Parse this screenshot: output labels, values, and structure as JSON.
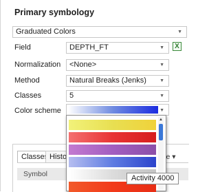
{
  "panel": {
    "title": "Primary symbology",
    "renderer": "Graduated Colors"
  },
  "fields": {
    "field_label": "Field",
    "field_value": "DEPTH_FT",
    "normalization_label": "Normalization",
    "normalization_value": "<None>",
    "method_label": "Method",
    "method_value": "Natural Breaks (Jenks)",
    "classes_label": "Classes",
    "classes_value": "5",
    "color_scheme_label": "Color scheme"
  },
  "expression_button": {
    "glyph": "X",
    "icon": "expression-icon"
  },
  "color_scheme_selected": {
    "stops": [
      "#ffffff",
      "#6f8be0",
      "#1c2ce0"
    ]
  },
  "tabs": [
    "Classes",
    "Histo"
  ],
  "table": {
    "symbol_header": "Symbol",
    "right_fragment": "re ▾"
  },
  "dropdown": {
    "swatches": [
      {
        "stops": [
          "#f2f27a",
          "#e8df52",
          "#f0d23a"
        ]
      },
      {
        "stops": [
          "#f47070",
          "#e83434",
          "#d61e1e"
        ]
      },
      {
        "stops": [
          "#c37ad0",
          "#a35ec0",
          "#8b4fa8"
        ]
      },
      {
        "stops": [
          "#b6bef0",
          "#5f7ce2",
          "#2b43cc"
        ]
      },
      {
        "stops": [
          "#ffffff",
          "#dcdcdc",
          "#c4c4c4"
        ]
      },
      {
        "stops": [
          "#f25a2a",
          "#f23a1a",
          "#e82e16"
        ]
      }
    ],
    "scrollbar_up": "▲"
  },
  "tooltip": "Activity 4000",
  "colors": {
    "accent": "#3a78d8",
    "border": "#c8c8c8"
  }
}
